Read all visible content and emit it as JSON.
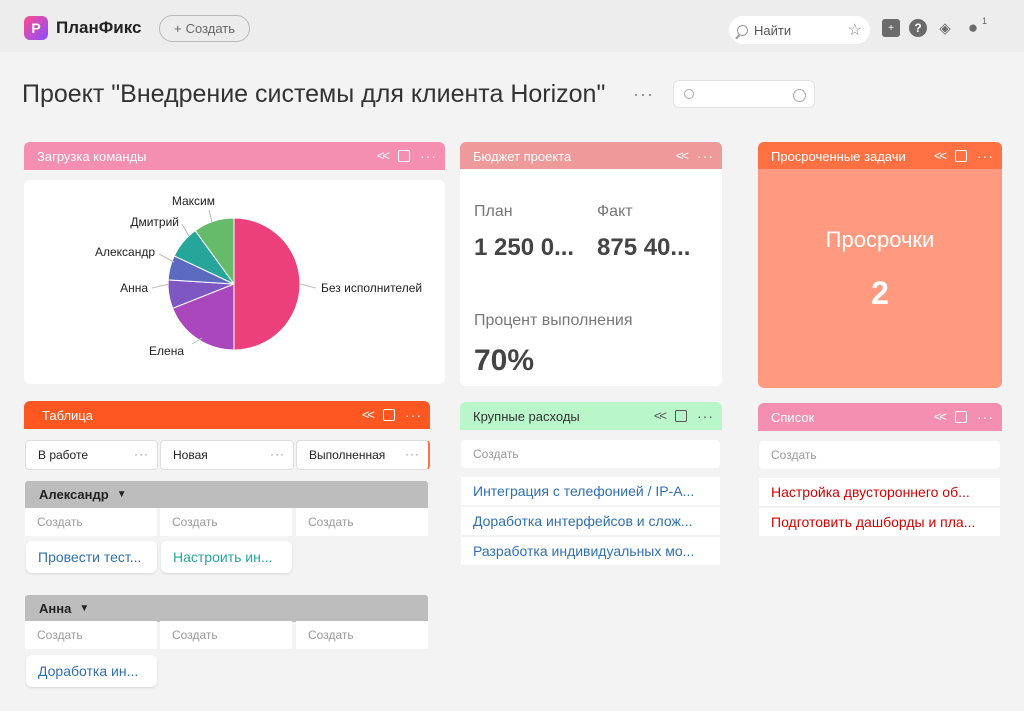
{
  "app": {
    "name": "ПланФикс",
    "logo_letter": "P"
  },
  "topbar": {
    "create_label": "Создать",
    "search_placeholder": "Найти",
    "notifications_count": "1"
  },
  "page": {
    "title": "Проект \"Внедрение системы для клиента Horizon\"",
    "more": "···"
  },
  "widgets": {
    "team_load": {
      "title": "Загрузка команды",
      "color": "#f48fb1",
      "chart_data": {
        "type": "pie",
        "slices": [
          {
            "label": "Без исполнителей",
            "value": 50,
            "color": "#ec407a"
          },
          {
            "label": "Елена",
            "value": 19,
            "color": "#ab47bc"
          },
          {
            "label": "Анна",
            "value": 7,
            "color": "#7e57c2"
          },
          {
            "label": "Александр",
            "value": 6,
            "color": "#5c6bc0"
          },
          {
            "label": "Дмитрий",
            "value": 8,
            "color": "#26a69a"
          },
          {
            "label": "Максим",
            "value": 10,
            "color": "#66bb6a"
          }
        ]
      }
    },
    "budget": {
      "title": "Бюджет проекта",
      "color": "#ef9a9a",
      "plan_label": "План",
      "plan_value": "1 250 0...",
      "fact_label": "Факт",
      "fact_value": "875 40...",
      "percent_label": "Процент выполнения",
      "percent_value": "70%"
    },
    "overdue": {
      "title": "Просроченные задачи",
      "color": "#ff7043",
      "label": "Просрочки",
      "count": "2"
    },
    "table": {
      "title": "Таблица",
      "color": "#ff5722",
      "statuses": [
        "В работе",
        "Новая",
        "Выполненная"
      ],
      "create_label": "Создать",
      "groups": [
        {
          "name": "Александр",
          "tasks": [
            {
              "text": "Провести тест...",
              "color": "#2f6fb0"
            },
            {
              "text": "Настроить ин...",
              "color": "#26a69a"
            }
          ]
        },
        {
          "name": "Анна",
          "tasks": [
            {
              "text": "Доработка ин...",
              "color": "#2f6fb0"
            }
          ]
        }
      ]
    },
    "big_expenses": {
      "title": "Крупные расходы",
      "color": "#b9f6ca",
      "create_label": "Создать",
      "items": [
        "Интеграция с телефонией / IP-А...",
        "Доработка интерфейсов и слож...",
        "Разработка индивидуальных мо..."
      ]
    },
    "list": {
      "title": "Список",
      "color": "#f48fb1",
      "create_label": "Создать",
      "items": [
        "Настройка двустороннего об...",
        "Подготовить дашборды и пла..."
      ]
    }
  }
}
